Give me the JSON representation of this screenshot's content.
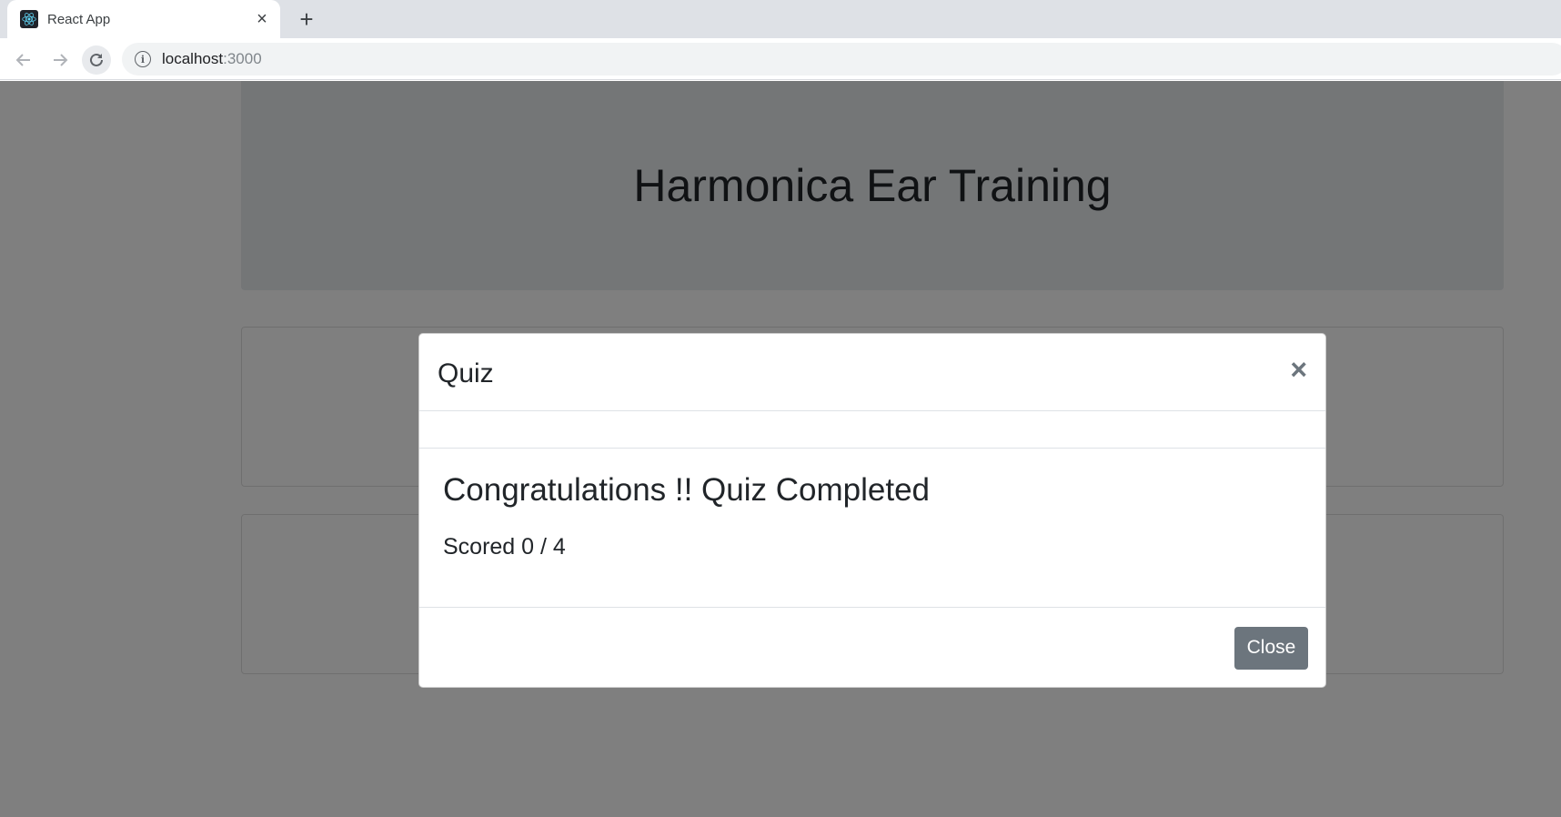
{
  "browser": {
    "tab_title": "React App",
    "url_host": "localhost",
    "url_port": ":3000"
  },
  "page": {
    "heading": "Harmonica Ear Training"
  },
  "modal": {
    "title": "Quiz",
    "close_symbol": "×",
    "congrats": "Congratulations !! Quiz Completed",
    "score": "Scored 0 / 4",
    "close_button": "Close"
  },
  "colors": {
    "jumbotron_bg": "#e9ecef",
    "button_secondary": "#6c757d",
    "backdrop": "rgba(0,0,0,0.5)"
  }
}
